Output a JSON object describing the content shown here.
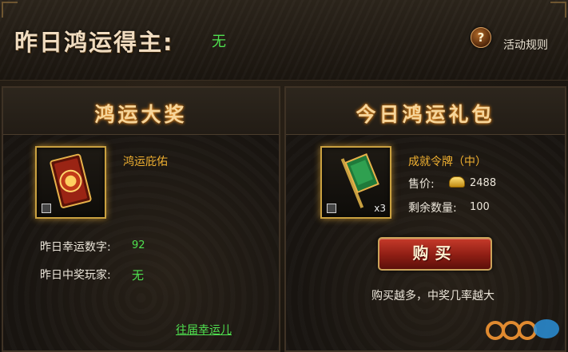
{
  "header": {
    "title_label": "昨日鸿运得主:",
    "title_value": "无",
    "help_icon_glyph": "?",
    "rules_link": "活动规则"
  },
  "left_panel": {
    "title": "鸿运大奖",
    "item_name": "鸿运庇佑",
    "lucky_number_label": "昨日幸运数字:",
    "lucky_number_value": "92",
    "winner_label": "昨日中奖玩家:",
    "winner_value": "无",
    "past_winners_link": "往届幸运儿"
  },
  "right_panel": {
    "title": "今日鸿运礼包",
    "item_name": "成就令牌（中）",
    "item_qty": "x3",
    "price_label": "售价:",
    "price_value": "2488",
    "remaining_label": "剩余数量:",
    "remaining_value": "100",
    "buy_button": "购买",
    "tip": "购买越多，中奖几率越大"
  },
  "colors": {
    "accent_gold": "#f6d59a",
    "value_green": "#4fe04f",
    "item_orange": "#f0b030",
    "button_red": "#8e1e14"
  },
  "icons": [
    "help-icon",
    "lock-icon",
    "gold-ingot-icon",
    "card-item-icon",
    "token-item-icon"
  ]
}
